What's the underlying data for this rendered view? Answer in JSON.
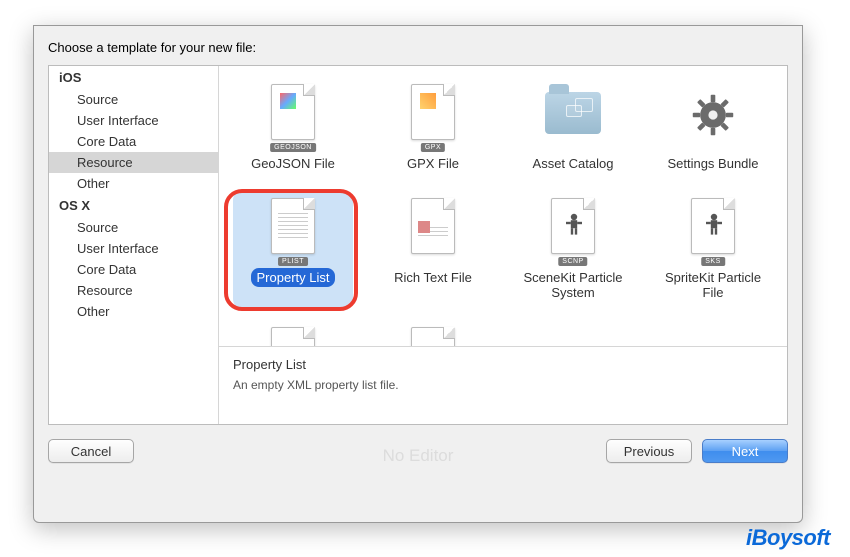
{
  "prompt": "Choose a template for your new file:",
  "sidebar": {
    "groups": [
      {
        "category": "iOS",
        "items": [
          {
            "label": "Source",
            "selected": false
          },
          {
            "label": "User Interface",
            "selected": false
          },
          {
            "label": "Core Data",
            "selected": false
          },
          {
            "label": "Resource",
            "selected": true
          },
          {
            "label": "Other",
            "selected": false
          }
        ]
      },
      {
        "category": "OS X",
        "items": [
          {
            "label": "Source",
            "selected": false
          },
          {
            "label": "User Interface",
            "selected": false
          },
          {
            "label": "Core Data",
            "selected": false
          },
          {
            "label": "Resource",
            "selected": false
          },
          {
            "label": "Other",
            "selected": false
          }
        ]
      }
    ]
  },
  "templates": {
    "row1": [
      {
        "name": "GeoJSON File",
        "badge": "GEOJSON",
        "kind": "file",
        "selected": false
      },
      {
        "name": "GPX File",
        "badge": "GPX",
        "kind": "file",
        "selected": false
      },
      {
        "name": "Asset Catalog",
        "badge": "",
        "kind": "folder",
        "selected": false
      },
      {
        "name": "Settings Bundle",
        "badge": "",
        "kind": "gear",
        "selected": false
      }
    ],
    "row2": [
      {
        "name": "Property List",
        "badge": "PLIST",
        "kind": "file-lines",
        "selected": true
      },
      {
        "name": "Rich Text File",
        "badge": "",
        "kind": "file-rtf",
        "selected": false
      },
      {
        "name": "SceneKit Particle System",
        "badge": "SCNP",
        "kind": "file-robot",
        "selected": false
      },
      {
        "name": "SpriteKit Particle File",
        "badge": "SKS",
        "kind": "file-robot",
        "selected": false
      }
    ]
  },
  "description": {
    "title": "Property List",
    "body": "An empty XML property list file."
  },
  "ghost": "No Editor",
  "buttons": {
    "cancel": "Cancel",
    "previous": "Previous",
    "next": "Next"
  },
  "watermark": "iBoysoft"
}
